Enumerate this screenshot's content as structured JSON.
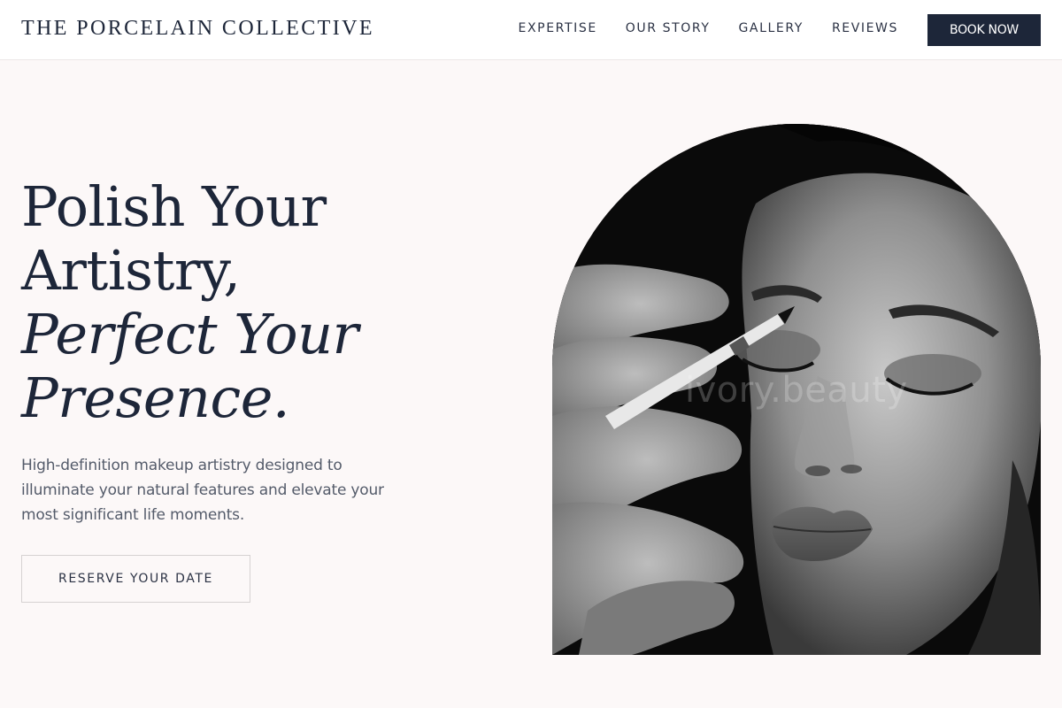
{
  "nav": {
    "brand": "THE PORCELAIN COLLECTIVE",
    "links": [
      "EXPERTISE",
      "OUR STORY",
      "GALLERY",
      "REVIEWS"
    ],
    "cta": "BOOK NOW"
  },
  "hero": {
    "title_lines": [
      "Polish Your",
      "Artistry,"
    ],
    "title_italic_lines": [
      "Perfect Your",
      "Presence."
    ],
    "subtitle": "High-definition makeup artistry designed to illuminate your natural features and elevate your most significant life moments.",
    "cta": "RESERVE YOUR DATE"
  },
  "image": {
    "watermark": "ivory.beauty",
    "subject": "black-and-white photo of a makeup artist applying eyeliner to a woman with closed eyes"
  },
  "colors": {
    "navy": "#1d2639",
    "page_bg": "#fcf8f8",
    "text_muted": "#545b6a"
  }
}
